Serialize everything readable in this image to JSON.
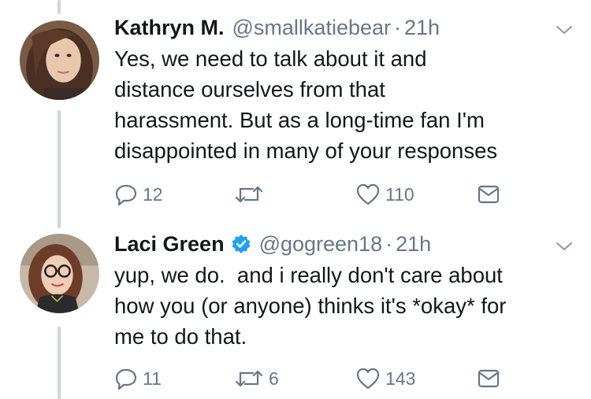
{
  "tweets": [
    {
      "name": "Kathryn M.",
      "handle": "@smallkatiebear",
      "dot": "·",
      "time": "21h",
      "verified": false,
      "text": "Yes, we need to talk about it and\ndistance ourselves from that\nharassment. But as a long-time fan I'm\ndisappointed in many of your responses",
      "replies": "12",
      "retweets": "",
      "likes": "110"
    },
    {
      "name": "Laci Green",
      "handle": "@gogreen18",
      "dot": "·",
      "time": "21h",
      "verified": true,
      "text": "yup, we do.  and i really don't care about\nhow you (or anyone) thinks it's *okay* for\nme to do that.",
      "replies": "11",
      "retweets": "6",
      "likes": "143"
    }
  ],
  "colors": {
    "text": "#14171a",
    "muted": "#657786",
    "thread_line": "#ccd6dd",
    "verified": "#1da1f2"
  },
  "icons": [
    "reply-icon",
    "retweet-icon",
    "like-icon",
    "dm-icon",
    "chevron-down-icon",
    "verified-badge-icon"
  ]
}
